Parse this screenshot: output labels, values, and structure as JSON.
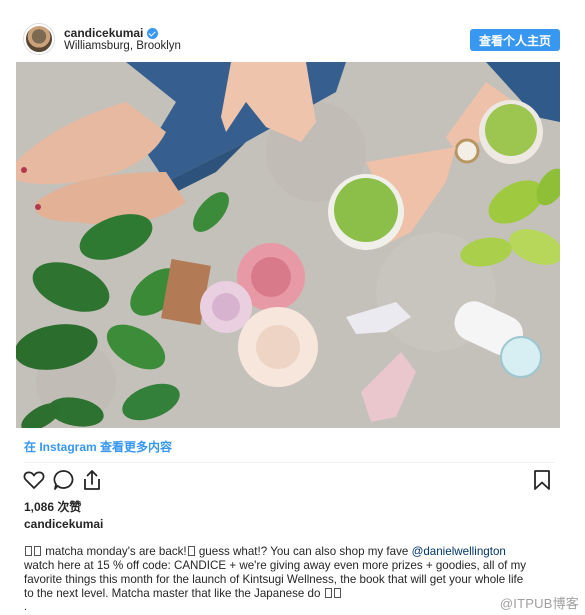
{
  "post": {
    "username": "candicekumai",
    "location": "Williamsburg, Brooklyn",
    "profile_button": "查看个人主页",
    "view_more": "在 Instagram 查看更多内容",
    "likes": "1,086 次赞",
    "author": "candicekumai",
    "caption": {
      "line1_before": " matcha monday's are back!",
      "line1_after": " guess what!? You can also shop my fave ",
      "mention": "@danielwellington",
      "line2": "watch here at 15 % off code: CANDICE + we're giving away even more prizes + goodies, all of my",
      "line3": "favorite things this month for the launch of Kintsugi Wellness, the book that will get your whole life",
      "line4": "to the next level. Matcha master that like the Japanese do "
    },
    "trailing_dot": ".",
    "watermark": "@ITPUB博客"
  },
  "colors": {
    "accent": "#3897f0",
    "mention": "#003569",
    "text": "#262626"
  },
  "icons": [
    "verified-badge-icon",
    "heart-icon",
    "comment-icon",
    "share-icon",
    "bookmark-icon"
  ]
}
